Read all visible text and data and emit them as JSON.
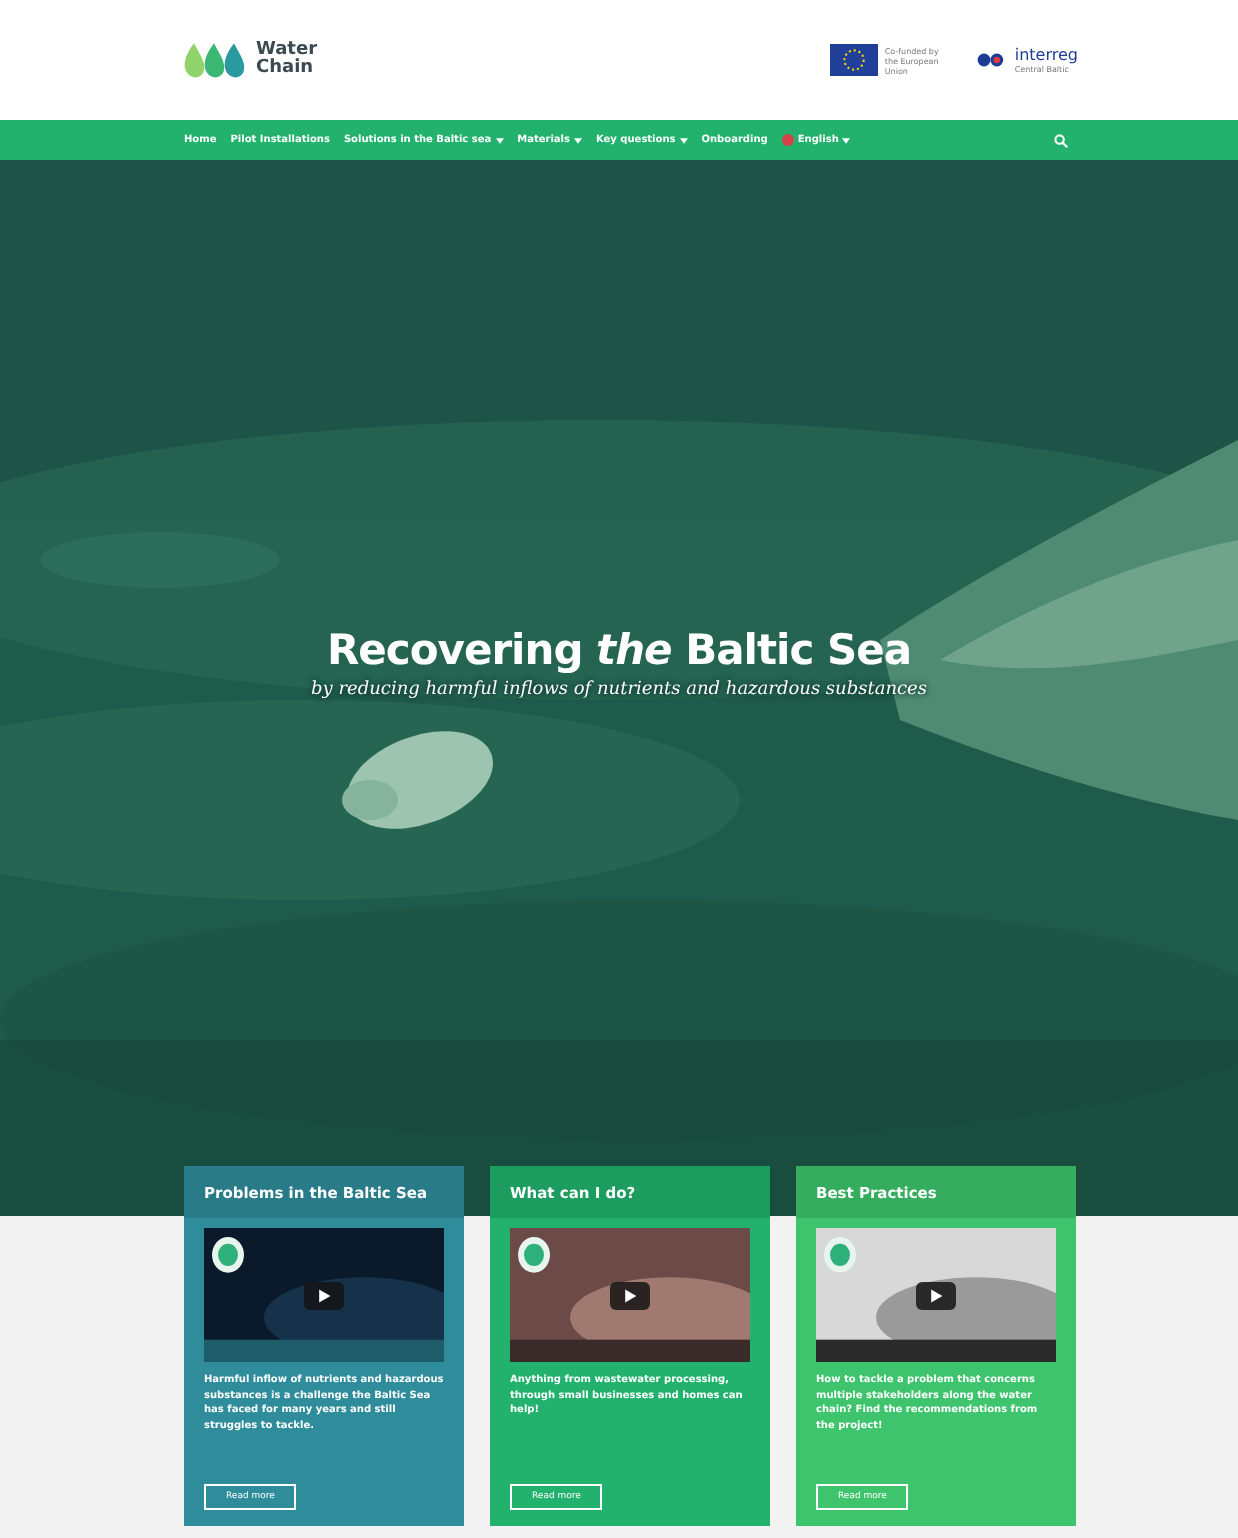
{
  "header": {
    "logo_text": [
      "Water",
      "Chain"
    ],
    "sponsors": [
      {
        "kind": "eu",
        "text": "Co-funded by the European Union"
      },
      {
        "kind": "interreg",
        "name": "interreg",
        "region": "Central Baltic"
      }
    ]
  },
  "nav": {
    "items": [
      {
        "label": "Home",
        "kind": "link",
        "has_dropdown": false
      },
      {
        "label": "Pilot Installations",
        "kind": "link",
        "has_dropdown": false
      },
      {
        "label": "Solutions in the Baltic sea",
        "kind": "link",
        "has_dropdown": true
      },
      {
        "label": "Materials",
        "kind": "link",
        "has_dropdown": true
      },
      {
        "label": "Key questions",
        "kind": "link",
        "has_dropdown": true
      },
      {
        "label": "Onboarding",
        "kind": "link",
        "has_dropdown": false
      },
      {
        "label": "English",
        "kind": "language",
        "has_dropdown": true
      }
    ]
  },
  "hero": {
    "title": "Recovering *the* Baltic Sea",
    "subtitle": "by reducing harmful inflows of nutrients and hazardous substances"
  },
  "cards": [
    {
      "title": "Problems in the Baltic Sea",
      "color": "#2f8d9b",
      "text": "Harmful inflow of nutrients and hazardous substances is a challenge the Baltic Sea has faced for many years and still struggles to tackle.",
      "button": "Read more"
    },
    {
      "title": "What can I do?",
      "color": "#22b26d",
      "text": "Anything from wastewater processing, through small businesses and homes can help!",
      "button": "Read more"
    },
    {
      "title": "Best Practices",
      "color": "#3ec46c",
      "text": "How to tackle a problem that concerns multiple stakeholders along the water chain? Find the recommendations from the project!",
      "button": "Read more"
    }
  ]
}
